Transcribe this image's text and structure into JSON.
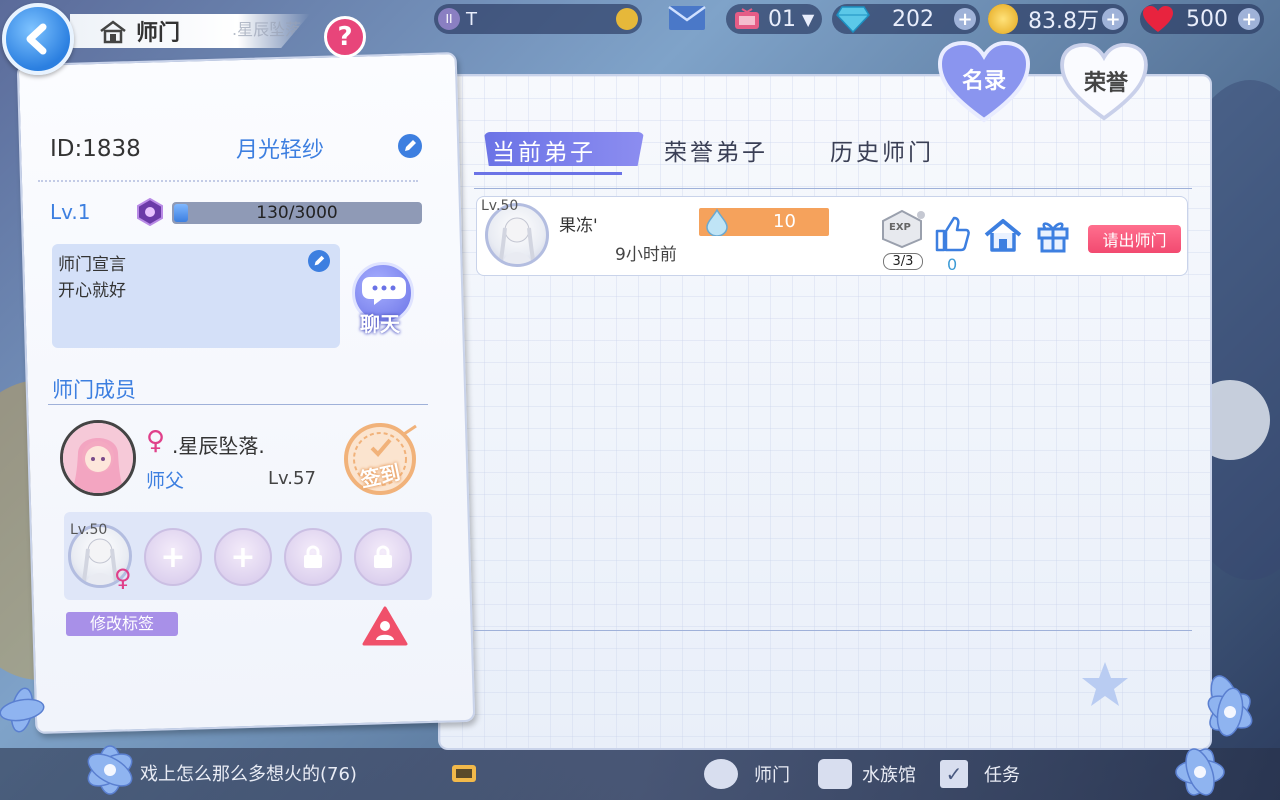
{
  "header": {
    "title": "师门",
    "title_shadow_text": ".星辰坠落.",
    "help_label": "?",
    "resources": {
      "name_field": "T",
      "tv_count": "01",
      "diamonds": "202",
      "coins": "83.8万",
      "hearts": "500"
    }
  },
  "side_tabs": {
    "roster": "名录",
    "honor": "荣誉"
  },
  "profile": {
    "id_label": "ID:1838",
    "name": "月光轻纱",
    "level": "Lv.1",
    "exp": "130/3000",
    "exp_progress": 0.043,
    "declaration_title": "师门宣言",
    "declaration_text": "开心就好",
    "chat_label": "聊天"
  },
  "members": {
    "section_title": "师门成员",
    "master": {
      "gender_symbol": "♀",
      "name": ".星辰坠落.",
      "role": "师父",
      "level": "Lv.57",
      "checkin_label": "签到"
    },
    "disciple_slot": {
      "level": "Lv.50",
      "gender_symbol": "♀"
    },
    "edit_tag_label": "修改标签"
  },
  "tabs": [
    {
      "label": "当前弟子",
      "active": true
    },
    {
      "label": "荣誉弟子",
      "active": false
    },
    {
      "label": "历史师门",
      "active": false
    }
  ],
  "disciples": [
    {
      "level": "Lv.50",
      "name": "果冻'",
      "last_online": "9小时前",
      "value": "10",
      "exp_count": "3/3",
      "exp_label": "EXP",
      "likes": "0",
      "kick_label": "请出师门"
    }
  ],
  "bottom_bar": {
    "chat_message": "戏上怎么那么多想火的(76)",
    "nav": [
      "师门",
      "水族馆",
      "任务"
    ]
  },
  "colors": {
    "accent": "#6b73e6",
    "primary_blue": "#3d7fe0",
    "danger": "#f24a70",
    "exp_bar": "#f5a25c"
  }
}
